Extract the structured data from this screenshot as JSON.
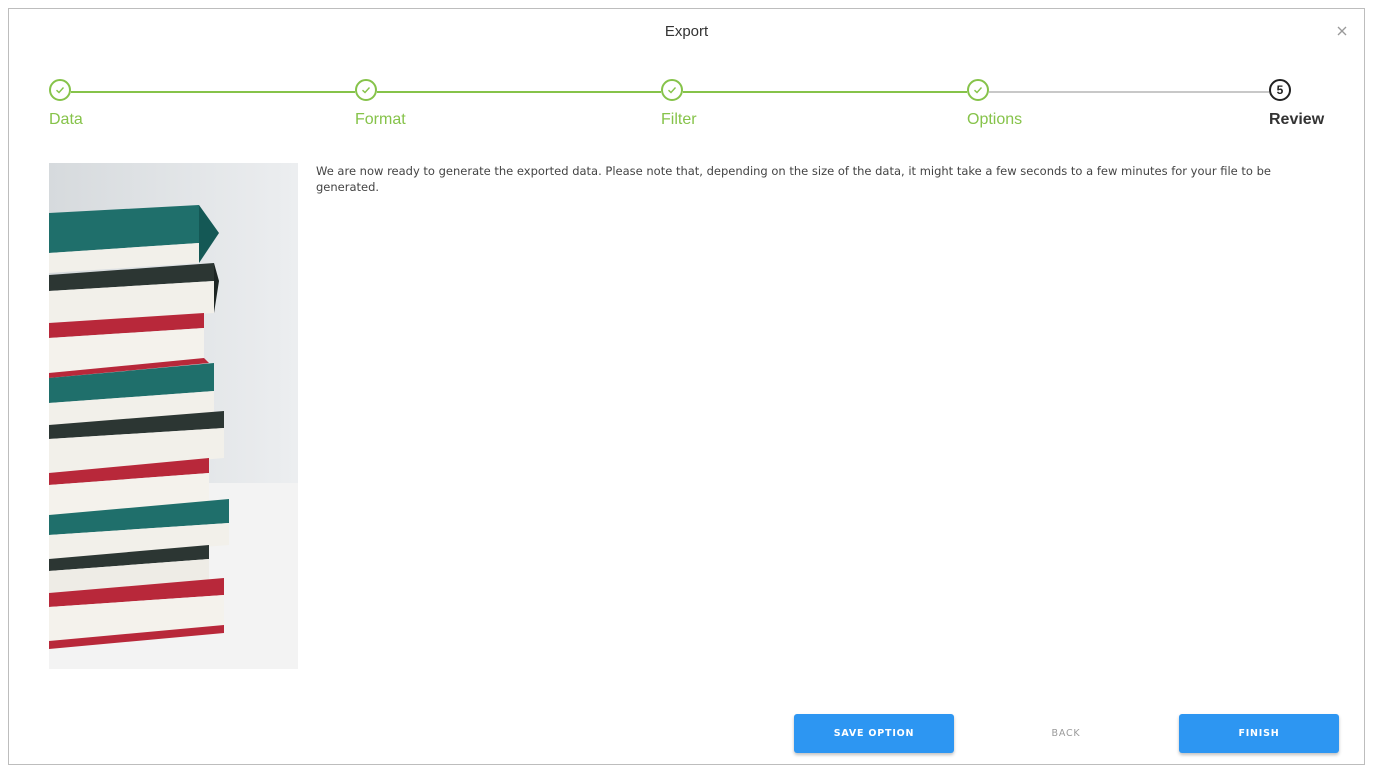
{
  "dialog": {
    "title": "Export",
    "close_icon": "close-icon"
  },
  "steps": [
    {
      "label": "Data",
      "status": "done"
    },
    {
      "label": "Format",
      "status": "done"
    },
    {
      "label": "Filter",
      "status": "done"
    },
    {
      "label": "Options",
      "status": "done"
    },
    {
      "label": "Review",
      "status": "active",
      "number": "5"
    }
  ],
  "colors": {
    "step_done": "#86c34a",
    "step_pending_line": "#c8c8c8",
    "button_primary": "#2d96f2"
  },
  "content": {
    "image": "stack-of-books",
    "message": "We are now ready to generate the exported data. Please note that, depending on the size of the data, it might take a few seconds to a few minutes for your file to be generated."
  },
  "footer": {
    "save_option_label": "SAVE OPTION",
    "back_label": "BACK",
    "finish_label": "FINISH"
  }
}
